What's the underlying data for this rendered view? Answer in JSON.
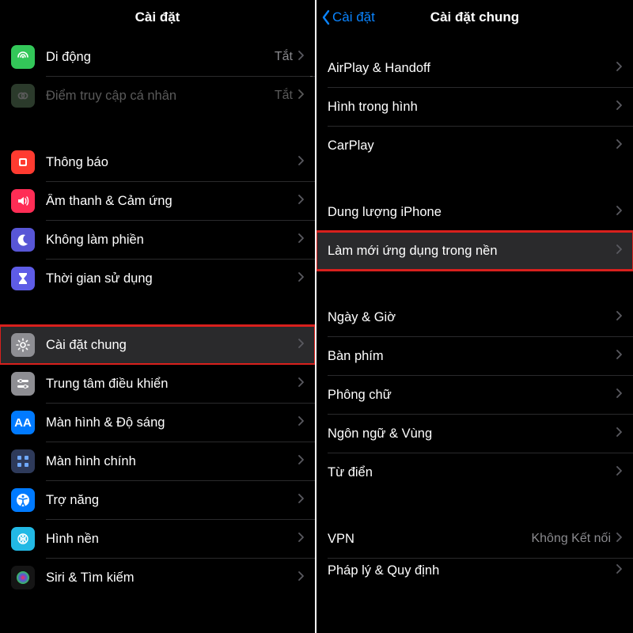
{
  "left": {
    "title": "Cài đặt",
    "rows": [
      {
        "icon": "cellular-icon",
        "bg": "ic-green",
        "label": "Di động",
        "value": "Tắt"
      },
      {
        "icon": "hotspot-icon",
        "bg": "ic-dark",
        "label": "Điểm truy cập cá nhân",
        "value": "Tắt",
        "muted": true
      },
      null,
      {
        "icon": "bell-icon",
        "bg": "ic-red",
        "label": "Thông báo"
      },
      {
        "icon": "speaker-icon",
        "bg": "ic-pink",
        "label": "Âm thanh & Cảm ứng"
      },
      {
        "icon": "moon-icon",
        "bg": "ic-purple",
        "label": "Không làm phiền"
      },
      {
        "icon": "hourglass-icon",
        "bg": "ic-indigo",
        "label": "Thời gian sử dụng"
      },
      null,
      {
        "icon": "gear-icon",
        "bg": "ic-gray",
        "label": "Cài đặt chung",
        "highlight": true
      },
      {
        "icon": "switches-icon",
        "bg": "ic-gray",
        "label": "Trung tâm điều khiển"
      },
      {
        "icon": "display-icon",
        "bg": "ic-blue",
        "label": "Màn hình & Độ sáng"
      },
      {
        "icon": "home-icon",
        "bg": "ic-deep",
        "label": "Màn hình chính"
      },
      {
        "icon": "accessibility-icon",
        "bg": "ic-blue",
        "label": "Trợ năng"
      },
      {
        "icon": "wallpaper-icon",
        "bg": "ic-cyan",
        "label": "Hình nền"
      },
      {
        "icon": "siri-icon",
        "bg": "ic-black",
        "label": "Siri & Tìm kiếm"
      }
    ]
  },
  "right": {
    "back": "Cài đặt",
    "title": "Cài đặt chung",
    "rows": [
      {
        "label": "AirPlay & Handoff"
      },
      {
        "label": "Hình trong hình"
      },
      {
        "label": "CarPlay"
      },
      null,
      {
        "label": "Dung lượng iPhone"
      },
      {
        "label": "Làm mới ứng dụng trong nền",
        "highlight": true
      },
      null,
      {
        "label": "Ngày & Giờ"
      },
      {
        "label": "Bàn phím"
      },
      {
        "label": "Phông chữ"
      },
      {
        "label": "Ngôn ngữ & Vùng"
      },
      {
        "label": "Từ điển"
      },
      null,
      {
        "label": "VPN",
        "value": "Không Kết nối"
      },
      {
        "label": "Pháp lý & Quy định",
        "partial": true
      }
    ]
  }
}
